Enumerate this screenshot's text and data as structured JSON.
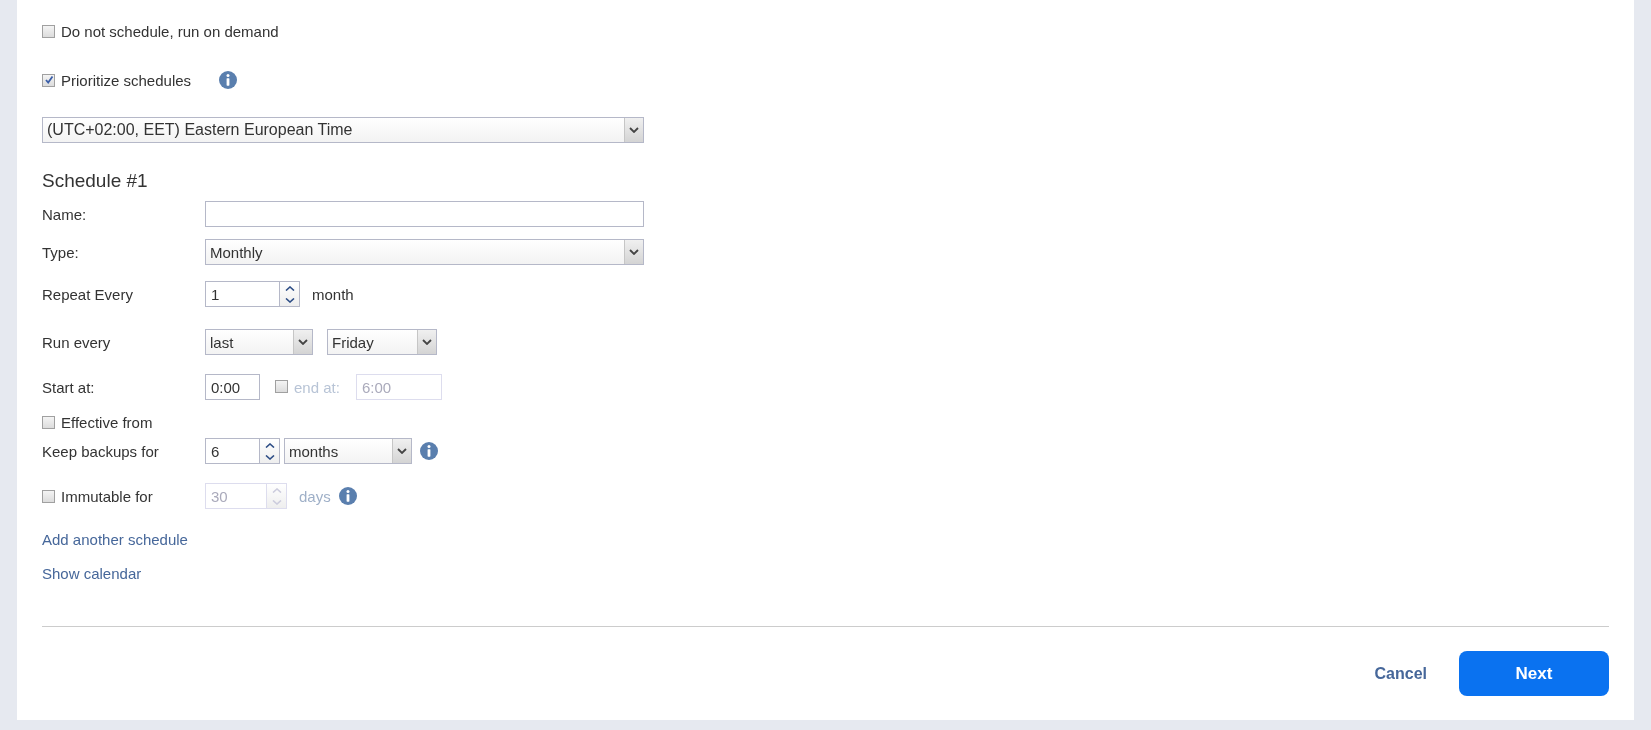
{
  "options": [
    {
      "label": "Do not schedule, run on demand",
      "checked": false,
      "info": false
    },
    {
      "label": "Prioritize schedules",
      "checked": true,
      "info": true
    }
  ],
  "timezone": {
    "value": "(UTC+02:00, EET) Eastern European Time"
  },
  "schedule": {
    "title": "Schedule #1",
    "rows": [
      {
        "kind": "text",
        "label": "Name:"
      },
      {
        "kind": "select",
        "label": "Type:",
        "value": "Monthly"
      },
      {
        "kind": "spinner",
        "label": "Repeat Every",
        "value": "1",
        "unit": "month"
      },
      {
        "kind": "selects",
        "label": "Run every",
        "selects": [
          "last",
          "Friday"
        ]
      },
      {
        "kind": "time",
        "label": "Start at:",
        "value": "0:00",
        "end": {
          "checked": false,
          "disabled": true,
          "label": "end at:",
          "value": "6:00"
        }
      },
      {
        "kind": "checkbox",
        "label": "Effective from",
        "checked": false
      },
      {
        "kind": "retention",
        "label": "Keep backups for",
        "value": "6",
        "period": "months",
        "info": true
      },
      {
        "kind": "immutable",
        "label": "Immutable for",
        "checked": false,
        "disabled": true,
        "value": "30",
        "unit": "days",
        "info": true
      }
    ]
  },
  "links": [
    "Add another schedule",
    "Show calendar"
  ],
  "buttons": [
    {
      "kind": "link",
      "label": "Cancel"
    },
    {
      "kind": "primary",
      "label": "Next"
    }
  ]
}
